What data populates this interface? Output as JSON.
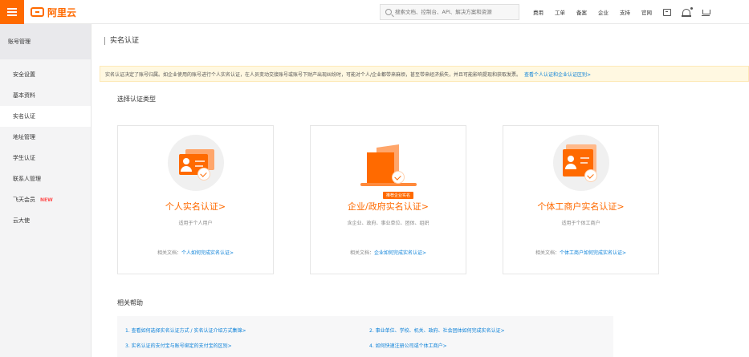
{
  "topbar": {
    "logo_text": "阿里云",
    "search_placeholder": "搜索文档、控制台、API、解决方案和资源",
    "nav": [
      "费用",
      "工单",
      "备案",
      "企业",
      "支持",
      "官网"
    ],
    "icons": [
      "terminal-icon",
      "bell-icon",
      "cart-icon"
    ]
  },
  "sidebar": {
    "header": "账号管理",
    "items": [
      {
        "label": "安全设置"
      },
      {
        "label": "基本资料"
      },
      {
        "label": "实名认证",
        "active": true
      },
      {
        "label": "地址管理"
      },
      {
        "label": "学生认证"
      },
      {
        "label": "联系人管理"
      },
      {
        "label": "飞天会员",
        "badge": "NEW"
      },
      {
        "label": "云大使"
      }
    ]
  },
  "main": {
    "title": "实名认证",
    "notice": "实名认证决定了账号归属。如企业使用的账号进行个人实名认证，在人员变动交接账号或账号下财产出现纠纷时，可能对个人/企业都带来麻烦，甚至带来经济损失，并且可能影响提现和获取发票。",
    "notice_link": "查看个人认证和企业认证区别>",
    "section_label": "选择认证类型",
    "cards": [
      {
        "title": "个人实名认证>",
        "sub": "适用于个人用户",
        "doc_label": "相关文档：",
        "doc_link": "个人如何完成实名认证>"
      },
      {
        "title": "企业/政府实名认证>",
        "badge": "推荐企业实名",
        "sub": "含企业、政府、事业单位、团体、组织",
        "doc_label": "相关文档：",
        "doc_link": "企业如何完成实名认证>"
      },
      {
        "title": "个体工商户实名认证>",
        "sub": "适用于个体工商户",
        "doc_label": "相关文档：",
        "doc_link": "个体工商户如何完成实名认证>"
      }
    ],
    "help_label": "相关帮助",
    "help_links": [
      "1. 查看如何选择实名认证方式 / 实名认证介绍方式集锦>",
      "2. 事业单位、学校、机关、政府、社会团体如何完成实名认证>",
      "3. 实名认证的支付宝与账号绑定的支付宝的区别>",
      "4. 如何快速注册公司或个体工商户>"
    ],
    "accent_color": "#ff6a00",
    "link_color": "#0a80d8"
  }
}
